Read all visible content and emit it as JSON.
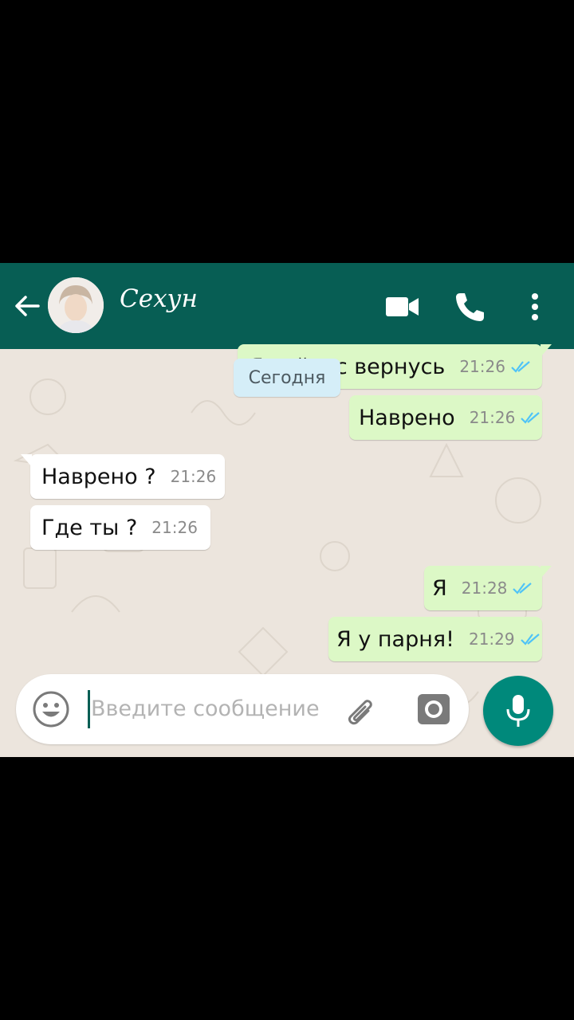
{
  "header": {
    "contact_name": "Сехун",
    "back_icon": "arrow-left-icon",
    "video_icon": "video-call-icon",
    "call_icon": "phone-icon",
    "menu_icon": "more-vertical-icon",
    "color": "#075e54"
  },
  "date_label": "Сегодня",
  "messages": [
    {
      "direction": "out",
      "text": "Я сейчас вернусь",
      "time": "21:26",
      "status": "read"
    },
    {
      "direction": "out",
      "text": "Наврено",
      "time": "21:26",
      "status": "read"
    },
    {
      "direction": "in",
      "text": "Наврено ?",
      "time": "21:26"
    },
    {
      "direction": "in",
      "text": "Где ты ?",
      "time": "21:26"
    },
    {
      "direction": "out",
      "text": "Я",
      "time": "21:28",
      "status": "read"
    },
    {
      "direction": "out",
      "text": "Я у парня!",
      "time": "21:29",
      "status": "read"
    }
  ],
  "composer": {
    "placeholder": "Введите сообщение",
    "emoji_icon": "emoji-icon",
    "attach_icon": "paperclip-icon",
    "camera_icon": "camera-icon",
    "mic_icon": "microphone-icon"
  },
  "colors": {
    "outgoing_bubble": "#dcf8c6",
    "incoming_bubble": "#ffffff",
    "read_tick": "#4fc3f7",
    "mic_button": "#00897b"
  }
}
